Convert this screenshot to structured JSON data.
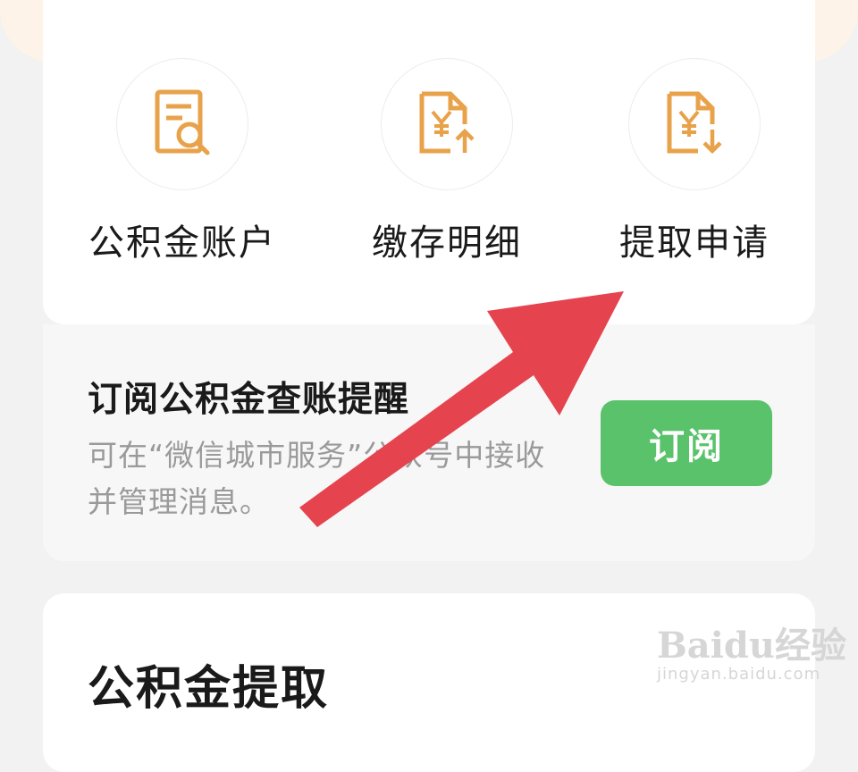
{
  "services": [
    {
      "label": "公积金账户",
      "icon": "document-search-icon"
    },
    {
      "label": "缴存明细",
      "icon": "yuan-upload-icon"
    },
    {
      "label": "提取申请",
      "icon": "yuan-download-icon"
    }
  ],
  "subscribe": {
    "title": "订阅公积金查账提醒",
    "description": "可在“微信城市服务”公众号中接收并管理消息。",
    "button_label": "订阅"
  },
  "section": {
    "title": "公积金提取"
  },
  "watermark": {
    "main": "Baidu经验",
    "sub": "jingyan.baidu.com"
  },
  "colors": {
    "accent_orange": "#e8a24a",
    "button_green": "#59c26b",
    "arrow_red": "#e5444f"
  }
}
